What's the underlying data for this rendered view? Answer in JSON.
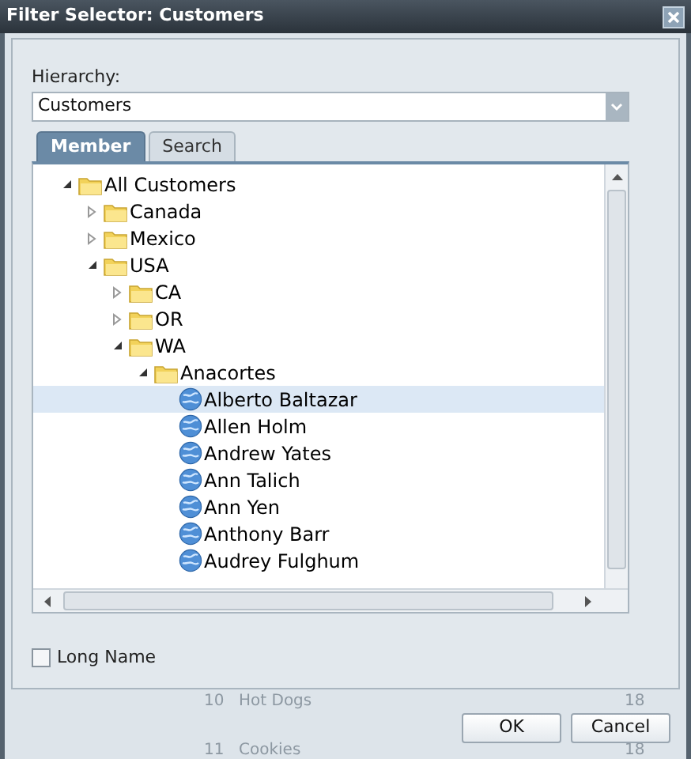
{
  "window": {
    "title": "Filter Selector: Customers"
  },
  "hierarchy": {
    "label": "Hierarchy:",
    "value": "Customers"
  },
  "tabs": [
    {
      "label": "Member",
      "selected": true
    },
    {
      "label": "Search",
      "selected": false
    }
  ],
  "tree": [
    {
      "label": "All Customers",
      "kind": "folder",
      "expanded": true,
      "selected": false,
      "children": [
        {
          "label": "Canada",
          "kind": "folder",
          "expanded": false,
          "selected": false
        },
        {
          "label": "Mexico",
          "kind": "folder",
          "expanded": false,
          "selected": false
        },
        {
          "label": "USA",
          "kind": "folder",
          "expanded": true,
          "selected": false,
          "children": [
            {
              "label": "CA",
              "kind": "folder",
              "expanded": false,
              "selected": false
            },
            {
              "label": "OR",
              "kind": "folder",
              "expanded": false,
              "selected": false
            },
            {
              "label": "WA",
              "kind": "folder",
              "expanded": true,
              "selected": false,
              "children": [
                {
                  "label": "Anacortes",
                  "kind": "folder",
                  "expanded": true,
                  "selected": false,
                  "children": [
                    {
                      "label": "Alberto Baltazar",
                      "kind": "member",
                      "selected": true
                    },
                    {
                      "label": "Allen Holm",
                      "kind": "member",
                      "selected": false
                    },
                    {
                      "label": "Andrew Yates",
                      "kind": "member",
                      "selected": false
                    },
                    {
                      "label": "Ann Talich",
                      "kind": "member",
                      "selected": false
                    },
                    {
                      "label": "Ann Yen",
                      "kind": "member",
                      "selected": false
                    },
                    {
                      "label": "Anthony Barr",
                      "kind": "member",
                      "selected": false
                    },
                    {
                      "label": "Audrey Fulghum",
                      "kind": "member",
                      "selected": false
                    }
                  ]
                }
              ]
            }
          ]
        }
      ]
    }
  ],
  "long_name": {
    "label": "Long Name",
    "checked": false
  },
  "background_rows": [
    {
      "number": "10",
      "name": "Hot Dogs",
      "value": "18"
    },
    {
      "number": "11",
      "name": "Cookies",
      "value": "18"
    }
  ],
  "buttons": [
    "OK",
    "Cancel"
  ]
}
